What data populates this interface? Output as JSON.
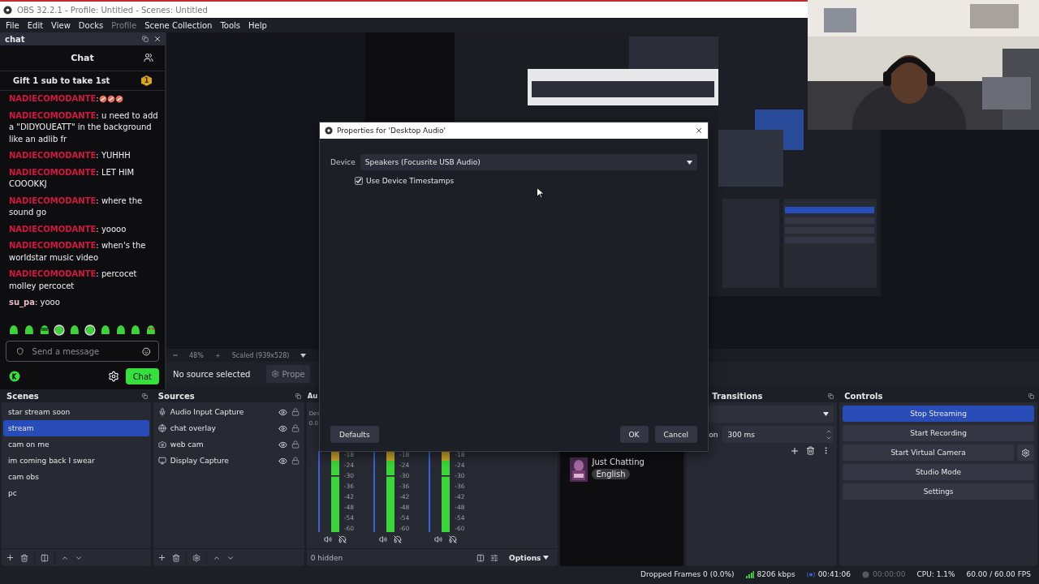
{
  "window": {
    "title": "OBS 32.2.1 - Profile: Untitled - Scenes: Untitled"
  },
  "menu": [
    {
      "label": "File",
      "disabled": false
    },
    {
      "label": "Edit",
      "disabled": false
    },
    {
      "label": "View",
      "disabled": false
    },
    {
      "label": "Docks",
      "disabled": false
    },
    {
      "label": "Profile",
      "disabled": true
    },
    {
      "label": "Scene Collection",
      "disabled": false
    },
    {
      "label": "Tools",
      "disabled": false
    },
    {
      "label": "Help",
      "disabled": false
    }
  ],
  "chat_dock": {
    "title": "chat",
    "header": "Chat",
    "pinned": {
      "text": "Gift 1 sub to take 1st",
      "badge": "1"
    },
    "messages": [
      {
        "user": "NADIECOMODANTE",
        "color": "#d3163f",
        "text": ":",
        "emotes": [
          {
            "kind": "disc"
          },
          {
            "kind": "disc"
          },
          {
            "kind": "disc"
          }
        ]
      },
      {
        "user": "NADIECOMODANTE",
        "color": "#d3163f",
        "text": ": u need to add a \"DIDYOUEATT\" in the background like an adlib fr"
      },
      {
        "user": "NADIECOMODANTE",
        "color": "#d3163f",
        "text": ": YUHHH"
      },
      {
        "user": "NADIECOMODANTE",
        "color": "#d3163f",
        "text": ": LET HIM COOOKKJ"
      },
      {
        "user": "NADIECOMODANTE",
        "color": "#d3163f",
        "text": ": where the sound go"
      },
      {
        "user": "NADIECOMODANTE",
        "color": "#d3163f",
        "text": ": yoooo"
      },
      {
        "user": "NADIECOMODANTE",
        "color": "#d3163f",
        "text": ": when's the worldstar music video"
      },
      {
        "user": "NADIECOMODANTE",
        "color": "#d3163f",
        "text": ": percocet molley percocet"
      },
      {
        "user": "su_pa",
        "color": "#e4b9cc",
        "text": ": yooo"
      }
    ],
    "emote_bar": [
      {
        "kind": "blob"
      },
      {
        "kind": "blob"
      },
      {
        "kind": "mask"
      },
      {
        "kind": "headset"
      },
      {
        "kind": "blob"
      },
      {
        "kind": "headset"
      },
      {
        "kind": "blob"
      },
      {
        "kind": "blob"
      },
      {
        "kind": "blob"
      },
      {
        "kind": "hearts"
      }
    ],
    "input": {
      "placeholder": "Send a message"
    },
    "send_button": "Chat"
  },
  "preview": {
    "zoom": "48%",
    "scale": "Scaled (939x528)"
  },
  "source_bar": {
    "status": "No source selected",
    "properties": "Prope"
  },
  "scenes": {
    "title": "Scenes",
    "items": [
      {
        "name": "star stream soon",
        "selected": false
      },
      {
        "name": "stream",
        "selected": true
      },
      {
        "name": "cam on me",
        "selected": false
      },
      {
        "name": "im coming back I swear",
        "selected": false
      },
      {
        "name": "cam obs",
        "selected": false
      },
      {
        "name": "pc",
        "selected": false
      }
    ]
  },
  "sources": {
    "title": "Sources",
    "items": [
      {
        "name": "Audio Input Capture",
        "kind": "mic"
      },
      {
        "name": "chat overlay",
        "kind": "browser"
      },
      {
        "name": "web cam",
        "kind": "camera"
      },
      {
        "name": "Display Capture",
        "kind": "display"
      }
    ]
  },
  "mixer": {
    "title": "Au",
    "channel_label": "Des",
    "channel_db": "0.0",
    "meters": [
      {
        "scale": [
          "-18",
          "-24",
          "-30",
          "-36",
          "-42",
          "-48",
          "-54",
          "-60"
        ]
      },
      {
        "scale": [
          "-18",
          "-24",
          "-30",
          "-36",
          "-42",
          "-48",
          "-54",
          "-60"
        ]
      },
      {
        "scale": [
          "-18",
          "-24",
          "-30",
          "-36",
          "-42",
          "-48",
          "-54",
          "-60"
        ]
      }
    ],
    "hidden": "0 hidden",
    "options": "Options"
  },
  "stream_info": {
    "category": "Just Chatting",
    "tag": "English"
  },
  "transitions": {
    "title": "Transitions",
    "duration_label": "on",
    "duration": "300 ms"
  },
  "controls": {
    "title": "Controls",
    "buttons": [
      {
        "label": "Stop Streaming",
        "active": true,
        "kind": "plain"
      },
      {
        "label": "Start Recording",
        "active": false,
        "kind": "plain"
      },
      {
        "label": "Start Virtual Camera",
        "active": false,
        "kind": "with_settings"
      },
      {
        "label": "Studio Mode",
        "active": false,
        "kind": "plain"
      },
      {
        "label": "Settings",
        "active": false,
        "kind": "plain"
      }
    ]
  },
  "status_bar": {
    "dropped": "Dropped Frames 0 (0.0%)",
    "bitrate": "8206 kbps",
    "stream_time": "00:41:06",
    "record_time": "00:00:00",
    "cpu": "CPU: 1.1%",
    "fps": "60.00 / 60.00 FPS"
  },
  "dialog": {
    "title": "Properties for 'Desktop Audio'",
    "device_label": "Device",
    "device": "Speakers (Focusrite USB Audio)",
    "timestamps": {
      "label": "Use Device Timestamps",
      "checked": true
    },
    "defaults": "Defaults",
    "ok": "OK",
    "cancel": "Cancel"
  }
}
